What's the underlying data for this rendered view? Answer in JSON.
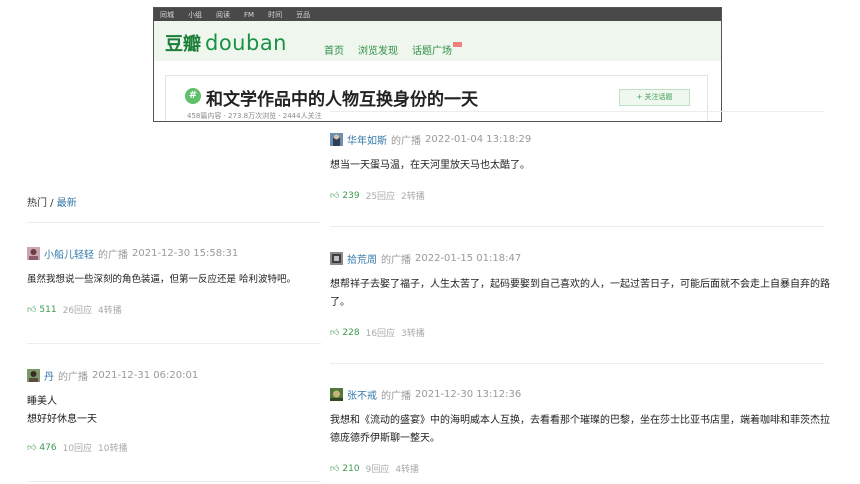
{
  "header": {
    "top_nav": [
      "同城",
      "小组",
      "阅读",
      "FM",
      "时间",
      "豆品"
    ],
    "logo_cn": "豆瓣",
    "logo_en": "douban",
    "nav": [
      "首页",
      "浏览发现",
      "话题广场"
    ]
  },
  "topic": {
    "badge": "#",
    "title": "和文学作品中的人物互换身份的一天",
    "stats": "458篇内容 · 273.8万次浏览 · 2444人关注",
    "follow_label": "+ 关注话题"
  },
  "tabs": {
    "hot": "热门",
    "divider": " / ",
    "latest": "最新"
  },
  "posts": [
    {
      "author": "华年如斯",
      "pre": "的广播",
      "time": "2022-01-04 13:18:29",
      "content": "想当一天蛋马温，在天河里放天马也太酷了。",
      "likes": "239",
      "replies": "25回应",
      "reposts": "2转播"
    },
    {
      "author": "小船儿轻轻",
      "pre": "的广播",
      "time": "2021-12-30 15:58:31",
      "content": "虽然我想说一些深刻的角色装逼，但第一反应还是 哈利波特吧。",
      "likes": "511",
      "replies": "26回应",
      "reposts": "4转播"
    },
    {
      "author": "拾荒周",
      "pre": "的广播",
      "time": "2022-01-15 01:18:47",
      "content": "想帮祥子去娶了福子，人生太苦了，起码要娶到自己喜欢的人，一起过苦日子，可能后面就不会走上自暴自弃的路了。",
      "likes": "228",
      "replies": "16回应",
      "reposts": "3转播"
    },
    {
      "author": "丹",
      "pre": "的广播",
      "time": "2021-12-31 06:20:01",
      "content_line1": "睡美人",
      "content_line2": "想好好休息一天",
      "likes": "476",
      "replies": "10回应",
      "reposts": "10转播"
    },
    {
      "author": "张不戒",
      "pre": "的广播",
      "time": "2021-12-30 13:12:36",
      "content": "我想和《流动的盛宴》中的海明威本人互换，去看看那个璀璨的巴黎，坐在莎士比亚书店里，端着咖啡和菲茨杰拉德庞德乔伊斯聊一整天。",
      "likes": "210",
      "replies": "9回应",
      "reposts": "4转播"
    }
  ]
}
